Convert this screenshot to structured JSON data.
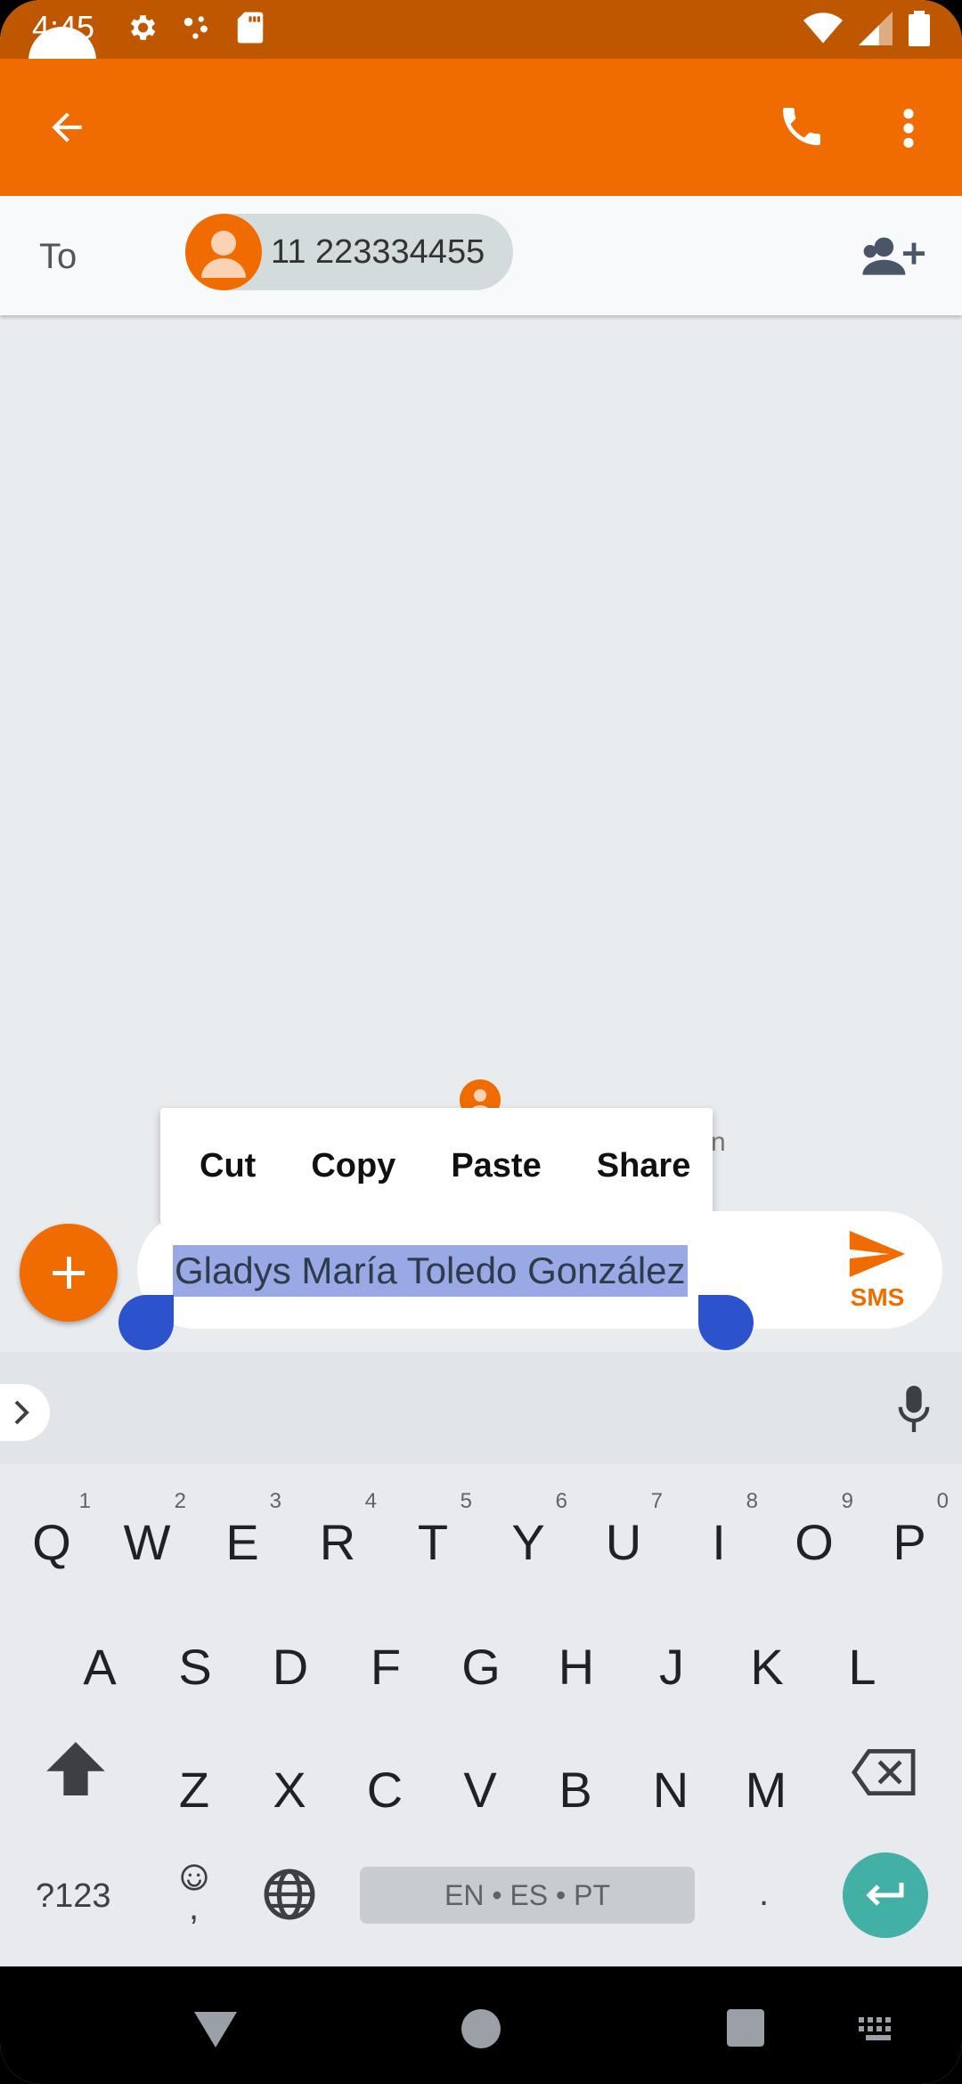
{
  "status_bar": {
    "time": "4:45"
  },
  "recipient": {
    "to_label": "To",
    "chip_number": "11 223334455"
  },
  "mini_text_fragment": "n",
  "context_menu": {
    "cut": "Cut",
    "copy": "Copy",
    "paste": "Paste",
    "share": "Share"
  },
  "compose": {
    "text": "Gladys María Toledo González",
    "send_label": "SMS"
  },
  "keyboard": {
    "row1": [
      {
        "letter": "Q",
        "hint": "1"
      },
      {
        "letter": "W",
        "hint": "2"
      },
      {
        "letter": "E",
        "hint": "3"
      },
      {
        "letter": "R",
        "hint": "4"
      },
      {
        "letter": "T",
        "hint": "5"
      },
      {
        "letter": "Y",
        "hint": "6"
      },
      {
        "letter": "U",
        "hint": "7"
      },
      {
        "letter": "I",
        "hint": "8"
      },
      {
        "letter": "O",
        "hint": "9"
      },
      {
        "letter": "P",
        "hint": "0"
      }
    ],
    "row2": [
      "A",
      "S",
      "D",
      "F",
      "G",
      "H",
      "J",
      "K",
      "L"
    ],
    "row3": [
      "Z",
      "X",
      "C",
      "V",
      "B",
      "N",
      "M"
    ],
    "symbols_label": "?123",
    "comma_label": ",",
    "space_label": "EN • ES • PT",
    "period_label": "."
  },
  "colors": {
    "app_bar": "#f06c00",
    "status_bar": "#bf5600",
    "selection": "#98a9e6",
    "handle": "#2c53cc",
    "enter": "#43b0a5"
  }
}
